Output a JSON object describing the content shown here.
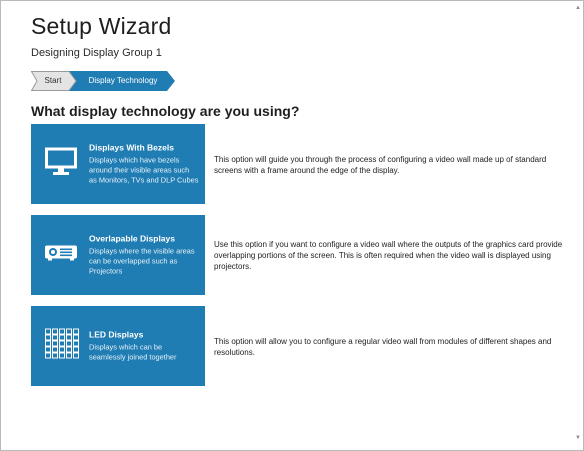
{
  "title": "Setup Wizard",
  "subtitle": "Designing Display Group 1",
  "breadcrumb": {
    "steps": [
      {
        "label": "Start"
      },
      {
        "label": "Display Technology"
      }
    ]
  },
  "question": "What display technology are you using?",
  "options": [
    {
      "title": "Displays With Bezels",
      "desc": "Displays which have bezels around their visible areas such as Monitors, TVs and DLP Cubes",
      "icon": "monitor-icon",
      "explanation": "This option will guide you through the process of configuring a video wall made up of standard screens with a frame around the edge of the display."
    },
    {
      "title": "Overlapable Displays",
      "desc": "Displays where the visible areas can be overlapped such as Projectors",
      "icon": "projector-icon",
      "explanation": "Use this option if you want to configure a video wall where the outputs of the graphics card provide overlapping portions of the screen. This is often required when the video wall is displayed using projectors."
    },
    {
      "title": "LED Displays",
      "desc": "Displays which can be seamlessly joined together",
      "icon": "led-grid-icon",
      "explanation": "This option will allow you to configure a regular video wall from modules of different shapes and resolutions."
    }
  ],
  "colors": {
    "accent": "#1f7db4",
    "crumb_inactive": "#e4e4e4"
  }
}
